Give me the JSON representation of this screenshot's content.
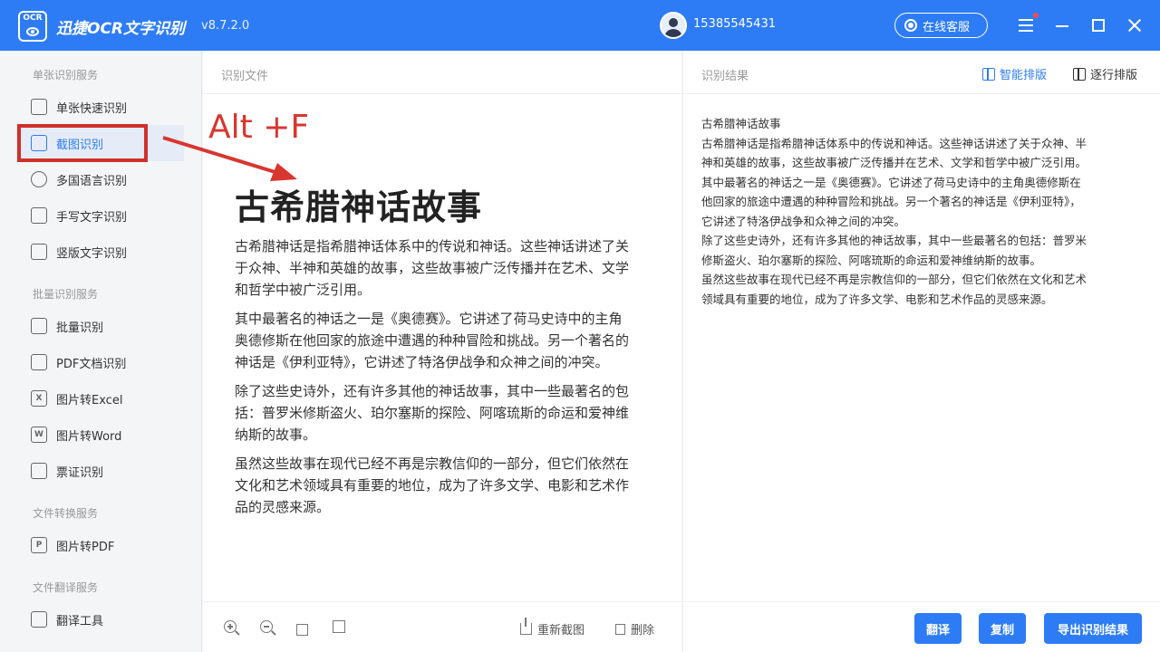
{
  "app": {
    "logo_text": "OCR",
    "name": "迅捷OCR文字识别",
    "version": "v8.7.2.0",
    "user_phone": "15385545431",
    "service_label": "在线客服"
  },
  "sidebar": {
    "sections": [
      {
        "title": "单张识别服务"
      },
      {
        "title": "批量识别服务"
      },
      {
        "title": "文件转换服务"
      },
      {
        "title": "文件翻译服务"
      }
    ],
    "items": [
      {
        "label": "单张快速识别",
        "icon": "image-scan-icon"
      },
      {
        "label": "截图识别",
        "icon": "crop-icon",
        "active": true
      },
      {
        "label": "多国语言识别",
        "icon": "globe-icon"
      },
      {
        "label": "手写文字识别",
        "icon": "pen-icon"
      },
      {
        "label": "竖版文字识别",
        "icon": "vertical-text-icon"
      },
      {
        "label": "批量识别",
        "icon": "copy-icon"
      },
      {
        "label": "PDF文档识别",
        "icon": "pdf-icon"
      },
      {
        "label": "图片转Excel",
        "icon": "excel-icon",
        "glyph": "X"
      },
      {
        "label": "图片转Word",
        "icon": "word-icon",
        "glyph": "W"
      },
      {
        "label": "票证识别",
        "icon": "id-card-icon"
      },
      {
        "label": "图片转PDF",
        "icon": "pdf-file-icon",
        "glyph": "P"
      },
      {
        "label": "翻译工具",
        "icon": "translate-icon"
      }
    ]
  },
  "annotation": {
    "shortcut": "Alt +F",
    "color": "#d8362f"
  },
  "center": {
    "header": "识别文件",
    "doc_title": "古希腊神话故事",
    "paragraphs": [
      [
        "古希腊神话是指希腊神话体系中的传说和神话。这些神话讲述了关",
        "于众神、半神和英雄的故事，这些故事被广泛传播并在艺术、文学",
        "和哲学中被广泛引用。"
      ],
      [
        "其中最著名的神话之一是《奥德赛》。它讲述了荷马史诗中的主角",
        "奥德修斯在他回家的旅途中遭遇的种种冒险和挑战。另一个著名的",
        "神话是《伊利亚特》，它讲述了特洛伊战争和众神之间的冲突。"
      ],
      [
        "除了这些史诗外，还有许多其他的神话故事，其中一些最著名的包",
        "括：普罗米修斯盗火、珀尔塞斯的探险、阿喀琉斯的命运和爱神维",
        "纳斯的故事。"
      ],
      [
        "虽然这些故事在现代已经不再是宗教信仰的一部分，但它们依然在",
        "文化和艺术领域具有重要的地位，成为了许多文学、电影和艺术作",
        "品的灵感来源。"
      ]
    ],
    "footer": {
      "recapture": "重新截图",
      "delete": "删除"
    }
  },
  "right": {
    "header": "识别结果",
    "smart_layout": "智能排版",
    "line_layout": "逐行排版",
    "lines": [
      "古希腊神话故事",
      "古希腊神话是指希腊神话体系中的传说和神话。这些神话讲述了关于众神、半",
      "神和英雄的故事，这些故事被广泛传播并在艺术、文学和哲学中被广泛引用。",
      "其中最著名的神话之一是《奥德赛》。它讲述了荷马史诗中的主角奥德修斯在",
      "他回家的旅途中遭遇的种种冒险和挑战。另一个著名的神话是《伊利亚特》，",
      "它讲述了特洛伊战争和众神之间的冲突。",
      "除了这些史诗外，还有许多其他的神话故事，其中一些最著名的包括：普罗米",
      "修斯盗火、珀尔塞斯的探险、阿喀琉斯的命运和爱神维纳斯的故事。",
      "虽然这些故事在现代已经不再是宗教信仰的一部分，但它们依然在文化和艺术",
      "领域具有重要的地位，成为了许多文学、电影和艺术作品的灵感来源。"
    ],
    "buttons": {
      "translate": "翻译",
      "copy": "复制",
      "export": "导出识别结果"
    }
  },
  "colors": {
    "primary": "#2d7cf6",
    "highlight_border": "#d0302a"
  }
}
